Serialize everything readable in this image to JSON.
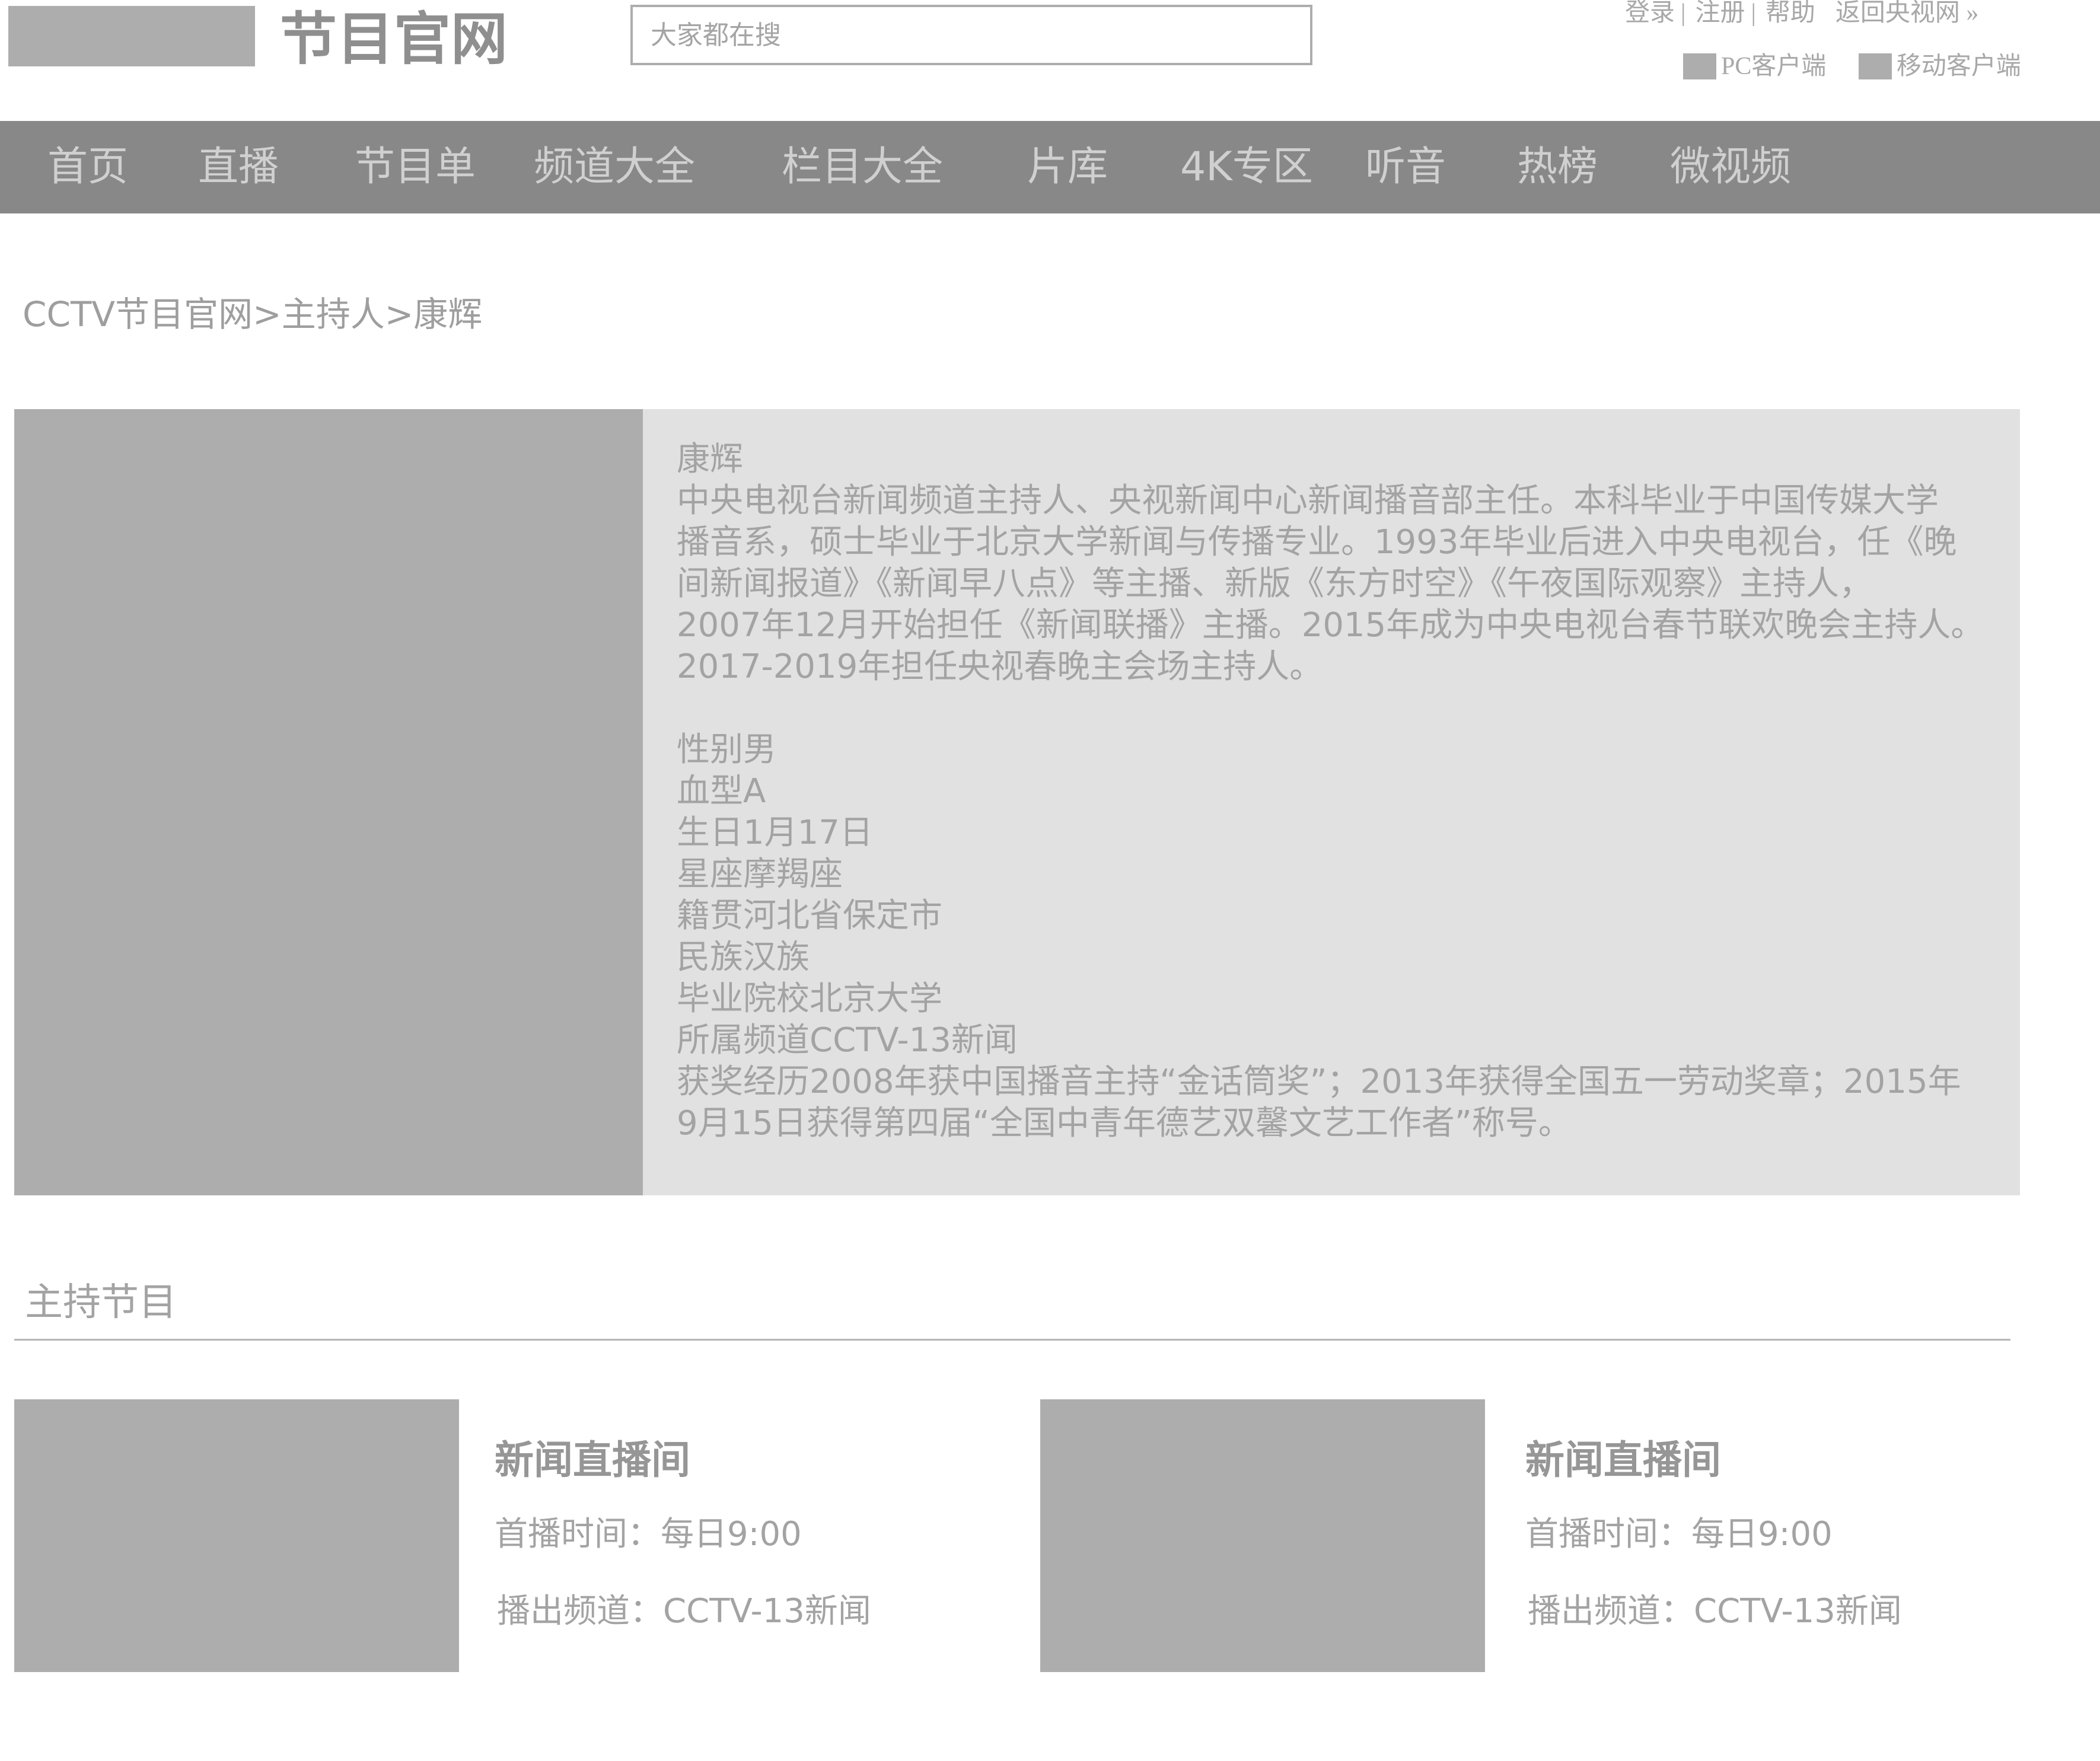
{
  "header": {
    "site_title": "节目官网",
    "search_placeholder": "大家都在搜",
    "top_links": {
      "login": "登录",
      "register": "注册",
      "help": "帮助",
      "back_to_cntv": "返回央视网 »",
      "separator": "|"
    },
    "clients": {
      "pc": "PC客户端",
      "mobile": "移动客户端"
    }
  },
  "nav": {
    "items": [
      "首页",
      "直播",
      "节目单",
      "频道大全",
      "栏目大全",
      "片库",
      "4K专区",
      "听音",
      "热榜",
      "微视频"
    ]
  },
  "breadcrumb": {
    "text": "CCTV节目官网>主持人>康辉"
  },
  "profile": {
    "name": "康辉",
    "bio": [
      "中央电视台新闻频道主持人、央视新闻中心新闻播音部主任。本科毕业于中国传媒大学",
      "播音系，硕士毕业于北京大学新闻与传播专业。1993年毕业后进入中央电视台，任《晚",
      "间新闻报道》《新闻早八点》等主播、新版《东方时空》《午夜国际观察》主持人，",
      "2007年12月开始担任《新闻联播》主播。2015年成为中央电视台春节联欢晚会主持人。",
      "2017-2019年担任央视春晚主会场主持人。"
    ],
    "facts": [
      "性别男",
      "血型A",
      "生日1月17日",
      "星座摩羯座",
      "籍贯河北省保定市",
      "民族汉族",
      "毕业院校北京大学",
      "所属频道CCTV-13新闻",
      "获奖经历2008年获中国播音主持“金话筒奖”；2013年获得全国五一劳动奖章；2015年",
      "9月15日获得第四届“全国中青年德艺双馨文艺工作者”称号。"
    ]
  },
  "programs": {
    "section_title": "主持节目",
    "items": [
      {
        "name": "新闻直播间",
        "air_time": "首播时间：每日9:00",
        "channel": "播出频道：CCTV-13新闻"
      },
      {
        "name": "新闻直播间",
        "air_time": "首播时间：每日9:00",
        "channel": "播出频道：CCTV-13新闻"
      }
    ]
  },
  "colors": {
    "nav_background": "#888888",
    "placeholder_gray": "#adadad",
    "info_panel": "#e1e1e1",
    "text_gray": "#a3a3a3"
  }
}
